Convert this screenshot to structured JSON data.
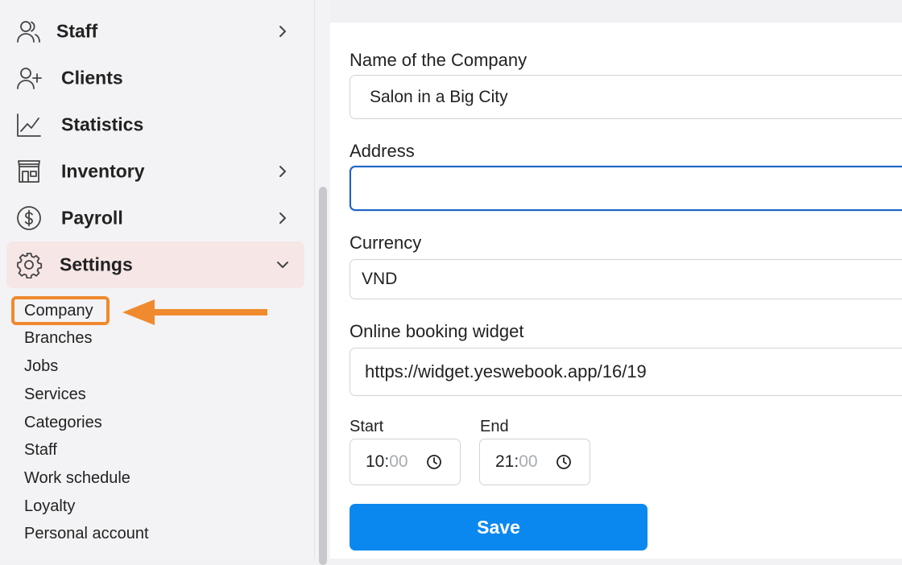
{
  "sidebar": {
    "items": [
      {
        "label": "Staff",
        "icon": "users-icon"
      },
      {
        "label": "Clients",
        "icon": "user-plus-icon"
      },
      {
        "label": "Statistics",
        "icon": "chart-line-icon"
      },
      {
        "label": "Inventory",
        "icon": "store-icon"
      },
      {
        "label": "Payroll",
        "icon": "dollar-circle-icon"
      },
      {
        "label": "Settings",
        "icon": "gear-icon"
      }
    ],
    "submenu": [
      "Company",
      "Branches",
      "Jobs",
      "Services",
      "Categories",
      "Staff",
      "Work schedule",
      "Loyalty",
      "Personal account"
    ]
  },
  "form": {
    "name_label": "Name of the Company",
    "name_value": "Salon in a Big City",
    "address_label": "Address",
    "address_value": "",
    "currency_label": "Currency",
    "currency_value": "VND",
    "widget_label": "Online booking widget",
    "widget_value": "https://widget.yeswebook.app/16/19",
    "start_label": "Start",
    "start_hour": "10:",
    "start_min": "00",
    "end_label": "End",
    "end_hour": "21:",
    "end_min": "00",
    "save_label": "Save"
  },
  "colors": {
    "accent": "#0a88f0",
    "focus": "#1e63c9",
    "active_bg": "#f6e6e6",
    "highlight": "#f08a2e"
  }
}
